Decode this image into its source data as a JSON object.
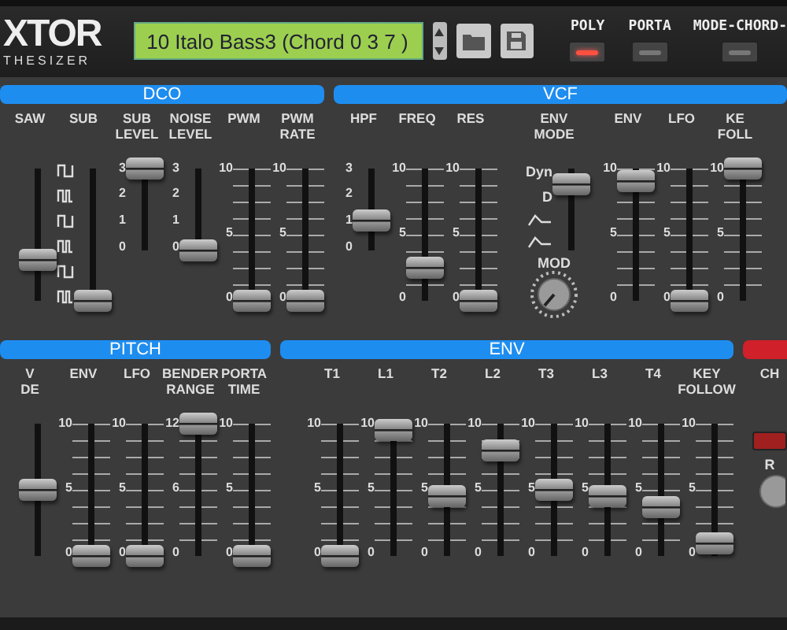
{
  "header": {
    "logo": "XTOR",
    "logo_sub": "THESIZER",
    "patch": "10 Italo Bass3 (Chord 0 3 7 )",
    "switches": [
      {
        "label": "POLY",
        "on": true
      },
      {
        "label": "PORTA",
        "on": false
      },
      {
        "label": "MODE-CHORD-",
        "on": false
      }
    ]
  },
  "rows": [
    {
      "sections": [
        {
          "title": "DCO",
          "color": "#1e8df0",
          "sliders": [
            {
              "kind": "scale",
              "label": [
                "SAW"
              ],
              "level": 0.3
            },
            {
              "kind": "waveform",
              "label": [
                "SUB"
              ],
              "level": 0
            },
            {
              "kind": "scale",
              "label": [
                "SUB",
                "LEVEL"
              ],
              "scale": [
                "3",
                "2",
                "1",
                "0"
              ],
              "level": 1.0,
              "short": true
            },
            {
              "kind": "scale",
              "label": [
                "NOISE",
                "LEVEL"
              ],
              "scale": [
                "3",
                "2",
                "1",
                "0"
              ],
              "level": 0.0,
              "short": true
            },
            {
              "kind": "scale",
              "label": [
                "PWM"
              ],
              "scale": [
                "10",
                "5",
                "0"
              ],
              "level": 0
            },
            {
              "kind": "scale",
              "label": [
                "PWM",
                "RATE"
              ],
              "scale": [
                "10",
                "5",
                "0"
              ],
              "level": 0
            }
          ]
        },
        {
          "title": "VCF",
          "color": "#1e8df0",
          "sliders": [
            {
              "kind": "scale",
              "label": [
                "HPF"
              ],
              "scale": [
                "3",
                "2",
                "1",
                "0"
              ],
              "level": 0.36,
              "short": true
            },
            {
              "kind": "scale",
              "label": [
                "FREQ"
              ],
              "scale": [
                "10",
                "5",
                "0"
              ],
              "level": 0.25
            },
            {
              "kind": "scale",
              "label": [
                "RES"
              ],
              "scale": [
                "10",
                "5",
                "0"
              ],
              "level": 0
            },
            {
              "kind": "mode",
              "label": [
                "ENV",
                "MODE"
              ],
              "marks": [
                "Dyn",
                "D"
              ],
              "knob": "MOD",
              "level": 0.8
            },
            {
              "kind": "scale",
              "label": [
                "ENV"
              ],
              "scale": [
                "10",
                "5",
                "0"
              ],
              "level": 0.9
            },
            {
              "kind": "scale",
              "label": [
                "LFO"
              ],
              "scale": [
                "10",
                "5",
                "0"
              ],
              "level": 0
            },
            {
              "kind": "scale",
              "label": [
                "KE",
                "FOLL"
              ],
              "scale": [
                "10",
                "5",
                "0"
              ],
              "level": 1.0
            }
          ]
        }
      ]
    },
    {
      "sections": [
        {
          "title": "PITCH",
          "color": "#1e8df0",
          "sliders": [
            {
              "kind": "scale",
              "label": [
                "V",
                "DE"
              ],
              "level": 0.5
            },
            {
              "kind": "scale",
              "label": [
                "ENV"
              ],
              "scale": [
                "10",
                "5",
                "0"
              ],
              "level": 0
            },
            {
              "kind": "scale",
              "label": [
                "LFO"
              ],
              "scale": [
                "10",
                "5",
                "0"
              ],
              "level": 0
            },
            {
              "kind": "scale",
              "label": [
                "BENDER",
                "RANGE"
              ],
              "scale": [
                "12",
                "6",
                "0"
              ],
              "level": 1.0
            },
            {
              "kind": "scale",
              "label": [
                "PORTA",
                "TIME"
              ],
              "scale": [
                "10",
                "5",
                "0"
              ],
              "level": 0
            }
          ]
        },
        {
          "title": "ENV",
          "color": "#1e8df0",
          "sliders": [
            {
              "kind": "scale",
              "label": [
                "T1"
              ],
              "scale": [
                "10",
                "5",
                "0"
              ],
              "level": 0
            },
            {
              "kind": "scale",
              "label": [
                "L1"
              ],
              "scale": [
                "10",
                "5",
                "0"
              ],
              "level": 0.95
            },
            {
              "kind": "scale",
              "label": [
                "T2"
              ],
              "scale": [
                "10",
                "5",
                "0"
              ],
              "level": 0.45
            },
            {
              "kind": "scale",
              "label": [
                "L2"
              ],
              "scale": [
                "10",
                "5",
                "0"
              ],
              "level": 0.8
            },
            {
              "kind": "scale",
              "label": [
                "T3"
              ],
              "scale": [
                "10",
                "5",
                "0"
              ],
              "level": 0.5
            },
            {
              "kind": "scale",
              "label": [
                "L3"
              ],
              "scale": [
                "10",
                "5",
                "0"
              ],
              "level": 0.45
            },
            {
              "kind": "scale",
              "label": [
                "T4"
              ],
              "scale": [
                "10",
                "5",
                "0"
              ],
              "level": 0.37
            },
            {
              "kind": "scale",
              "label": [
                "KEY",
                "FOLLOW"
              ],
              "scale": [
                "10",
                "5",
                "0"
              ],
              "level": 0.1
            }
          ]
        },
        {
          "color": "#d0202a",
          "sliders": [
            {
              "kind": "button",
              "label": [
                "CH"
              ],
              "marks": [
                "R"
              ]
            }
          ]
        }
      ]
    }
  ]
}
